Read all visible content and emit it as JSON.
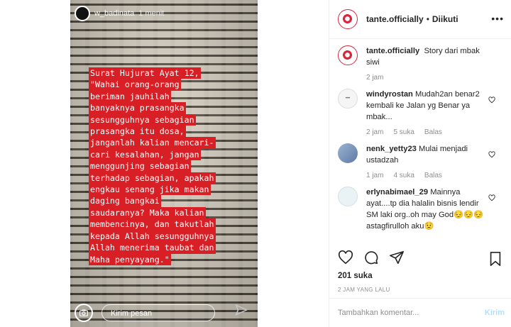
{
  "story": {
    "username": "w_badinata",
    "time": "1 menit",
    "quote_lines": [
      "Surat Hujurat Ayat 12,",
      "\"Wahai orang-orang",
      "beriman jauhilah",
      "banyaknya prasangka",
      "sesungguhnya sebagian",
      "prasangka itu dosa,",
      "janganlah kalian mencari-",
      "cari kesalahan, jangan",
      "menggunjing sebagian",
      "terhadap sebagian, apakah",
      "engkau senang jika makan",
      "daging bangkai",
      "saudaranya? Maka kalian",
      "membencinya, dan takutlah",
      "kepada Allah sesungguhnya",
      "Allah menerima taubat dan",
      "Maha penyayang.\""
    ],
    "message_placeholder": "Kirim pesan",
    "highlight_color": "#d91f26"
  },
  "header": {
    "username": "tante.officially",
    "separator": "•",
    "follow_label": "Diikuti",
    "more": "•••"
  },
  "caption": {
    "username": "tante.officially",
    "text": "Story dari mbak siwi",
    "time": "2 jam"
  },
  "comments": [
    {
      "username": "windyrostan",
      "text": "Mudah2an benar2 kembali ke Jalan yg Benar ya mbak...",
      "time": "2 jam",
      "likes": "5 suka",
      "reply": "Balas"
    },
    {
      "username": "nenk_yetty23",
      "text": "Mulai menjadi ustadzah",
      "time": "1 jam",
      "likes": "4 suka",
      "reply": "Balas"
    },
    {
      "username": "erlynabimael_29",
      "text": "Mainnya ayat....tp dia halalin bisnis lendir SM laki org..oh may God😔😔😔astagfirulloh aku😟",
      "time": "",
      "likes": "",
      "reply": ""
    }
  ],
  "post": {
    "likes": "201 suka",
    "posted": "2 JAM YANG LALU",
    "add_comment_placeholder": "Tambahkan komentar...",
    "post_button": "Kirim"
  },
  "icons": {
    "like": "heart-icon",
    "comment": "comment-icon",
    "share": "send-icon",
    "save": "bookmark-icon",
    "camera": "camera-icon"
  }
}
